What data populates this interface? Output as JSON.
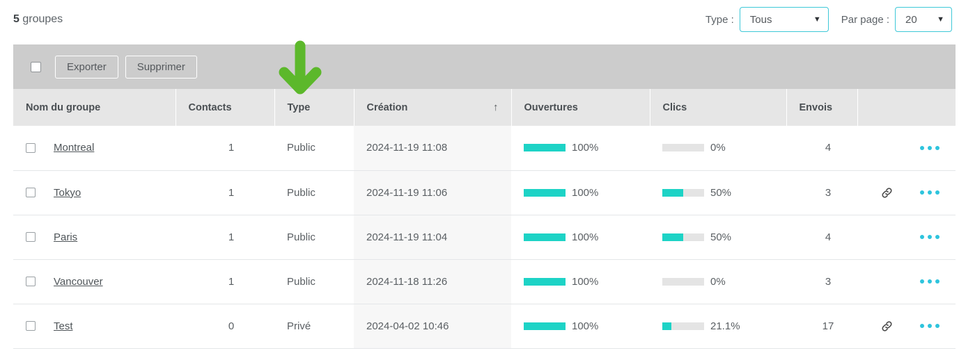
{
  "header": {
    "count": "5",
    "count_unit": "groupes",
    "type_filter_label": "Type :",
    "type_filter_value": "Tous",
    "per_page_label": "Par page :",
    "per_page_value": "20",
    "caret_icon": "chevron-down-icon"
  },
  "toolbar": {
    "export_label": "Exporter",
    "delete_label": "Supprimer",
    "select_all_icon": "checkbox-unchecked-icon"
  },
  "table": {
    "columns": [
      {
        "label": "Nom du groupe"
      },
      {
        "label": "Contacts"
      },
      {
        "label": "Type"
      },
      {
        "label": "Création",
        "sort_icon": "arrow-up-icon",
        "sorted": "asc"
      },
      {
        "label": "Ouvertures"
      },
      {
        "label": "Clics"
      },
      {
        "label": "Envois"
      },
      {
        "label": ""
      }
    ],
    "rows": [
      {
        "name": "Montreal",
        "contacts": "1",
        "type": "Public",
        "creation": "2024-11-19 11:08",
        "ouvertures_pct": 100,
        "ouvertures_label": "100%",
        "clics_pct": 0,
        "clics_label": "0%",
        "envois": "4",
        "has_link": false,
        "menu_icon": "ellipsis-icon"
      },
      {
        "name": "Tokyo",
        "contacts": "1",
        "type": "Public",
        "creation": "2024-11-19 11:06",
        "ouvertures_pct": 100,
        "ouvertures_label": "100%",
        "clics_pct": 50,
        "clics_label": "50%",
        "envois": "3",
        "has_link": true,
        "menu_icon": "ellipsis-icon"
      },
      {
        "name": "Paris",
        "contacts": "1",
        "type": "Public",
        "creation": "2024-11-19 11:04",
        "ouvertures_pct": 100,
        "ouvertures_label": "100%",
        "clics_pct": 50,
        "clics_label": "50%",
        "envois": "4",
        "has_link": false,
        "menu_icon": "ellipsis-icon"
      },
      {
        "name": "Vancouver",
        "contacts": "1",
        "type": "Public",
        "creation": "2024-11-18 11:26",
        "ouvertures_pct": 100,
        "ouvertures_label": "100%",
        "clics_pct": 0,
        "clics_label": "0%",
        "envois": "3",
        "has_link": false,
        "menu_icon": "ellipsis-icon"
      },
      {
        "name": "Test",
        "contacts": "0",
        "type": "Privé",
        "creation": "2024-04-02 10:46",
        "ouvertures_pct": 100,
        "ouvertures_label": "100%",
        "clics_pct": 21.1,
        "clics_label": "21.1%",
        "envois": "17",
        "has_link": true,
        "menu_icon": "ellipsis-icon"
      }
    ]
  },
  "annotation": {
    "arrow_icon": "arrow-down-icon",
    "color": "#5cb82b"
  },
  "colors": {
    "accent_teal": "#1dd3c6",
    "dots_blue": "#2ec4dd",
    "select_border": "#3ec8d8",
    "toolbar_gray": "#cccccc",
    "header_gray": "#e6e6e6"
  }
}
